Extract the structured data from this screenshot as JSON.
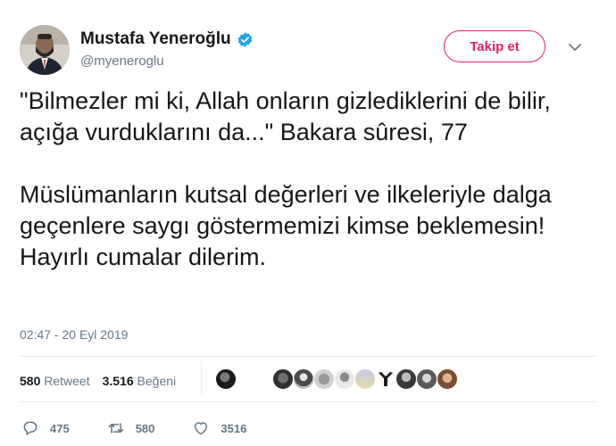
{
  "user": {
    "name": "Mustafa Yeneroğlu",
    "handle": "@myeneroglu",
    "verified_icon": "verified-badge-icon"
  },
  "header": {
    "follow_label": "Takip et",
    "menu_icon": "chevron-down-icon"
  },
  "tweet": {
    "text": "\"Bilmezler mi ki, Allah onların gizlediklerini de bilir, açığa vurduklarını da...\" Bakara sûresi, 77\n\nMüslümanların kutsal değerleri ve ilkeleriyle dalga geçenlere saygı göstermemizi kimse beklemesin!\nHayırlı cumalar dilerim.",
    "timestamp": "02:47 - 20 Eyl 2019"
  },
  "stats": {
    "retweets_count": "580",
    "retweets_label": "Retweet",
    "likes_count": "3.516",
    "likes_label": "Beğeni"
  },
  "actions": {
    "reply_count": "475",
    "retweet_count": "580",
    "like_count": "3516"
  },
  "colors": {
    "accent": "#e0245e",
    "verified": "#1da1f2",
    "muted": "#657786",
    "divider": "#e6ecf0"
  }
}
